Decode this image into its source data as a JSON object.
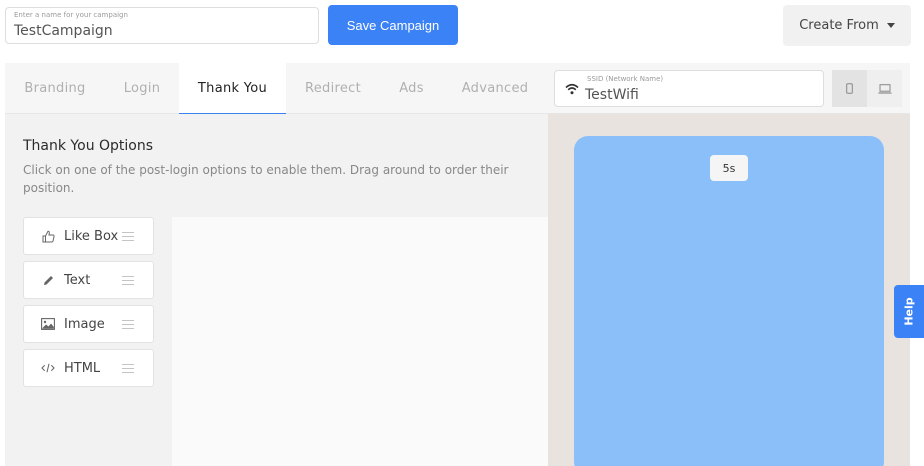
{
  "header": {
    "campaign_name_label": "Enter a name for your campaign",
    "campaign_name_value": "TestCampaign",
    "save_label": "Save Campaign",
    "create_from_label": "Create From"
  },
  "tabs": [
    {
      "label": "Branding"
    },
    {
      "label": "Login"
    },
    {
      "label": "Thank You",
      "active": true
    },
    {
      "label": "Redirect"
    },
    {
      "label": "Ads"
    },
    {
      "label": "Advanced"
    }
  ],
  "ssid": {
    "label": "SSID (Network Name)",
    "value": "TestWifi"
  },
  "devices": [
    "phone-icon",
    "laptop-icon"
  ],
  "options_panel": {
    "title": "Thank You Options",
    "description": "Click on one of the post-login options to enable them. Drag around to order their position.",
    "items": [
      {
        "label": "Like Box",
        "icon": "thumbs-up-icon"
      },
      {
        "label": "Text",
        "icon": "pencil-icon"
      },
      {
        "label": "Image",
        "icon": "image-icon"
      },
      {
        "label": "HTML",
        "icon": "code-icon"
      }
    ]
  },
  "preview": {
    "timer": "5s"
  },
  "help": {
    "label": "Help"
  },
  "colors": {
    "accent": "#3b82f6",
    "preview_screen": "#8bbff9"
  }
}
